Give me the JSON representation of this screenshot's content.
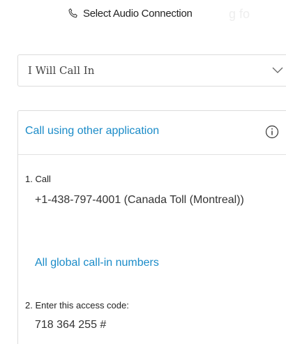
{
  "header": {
    "icon": "phone-icon",
    "title": "Select Audio Connection",
    "ghost_text": "g fo"
  },
  "audio_select": {
    "value": "I Will Call In",
    "icon": "chevron-down-icon"
  },
  "call_panel": {
    "title": "Call using other application",
    "info_icon": "info-icon",
    "step1_label": "1. Call",
    "phone_number": "+1-438-797-4001 (Canada Toll (Montreal))",
    "global_numbers_link": "All global call-in numbers",
    "step2_label": "2. Enter this access code:",
    "access_code": "718 364 255 #"
  },
  "colors": {
    "link": "#1a8bc8",
    "border": "#dcdcdc",
    "text": "#333333"
  }
}
